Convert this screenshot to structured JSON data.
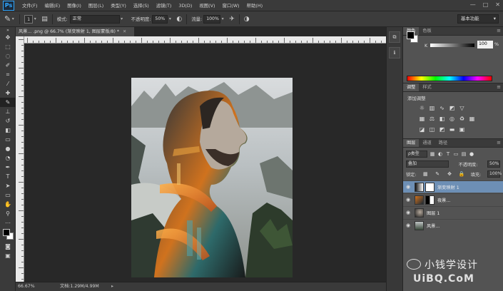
{
  "menubar": {
    "logo": "Ps",
    "items": [
      "文件(F)",
      "编辑(E)",
      "图像(I)",
      "图层(L)",
      "类型(Y)",
      "选择(S)",
      "滤镜(T)",
      "3D(D)",
      "视图(V)",
      "窗口(W)",
      "帮助(H)"
    ],
    "window_controls": [
      "—",
      "□",
      "✕"
    ]
  },
  "options": {
    "brush_size": "1",
    "mode_label": "模式:",
    "mode_value": "正常",
    "opacity_label": "不透明度:",
    "opacity_value": "50%",
    "flow_label": "流量:",
    "flow_value": "100%",
    "workspace": "基本功能"
  },
  "document": {
    "tab_title": "风景... .png @ 66.7% (渐变映射 1, 图层蒙版/8) *",
    "zoom": "66.67%",
    "doc_size": "文档:1.29M/4.99M"
  },
  "panels": {
    "color_tabs": [
      "颜色",
      "色板"
    ],
    "color_k_label": "K",
    "color_k_value": "100",
    "color_k_unit": "%",
    "adj_tabs": [
      "调整",
      "样式"
    ],
    "adj_title": "添加调整",
    "layers_tabs": [
      "图层",
      "通道",
      "路径"
    ],
    "kind_label": "ρ类型",
    "blend_mode": "叠加",
    "opacity_label": "不透明度:",
    "opacity_value": "50%",
    "lock_label": "锁定:",
    "fill_label": "填充:",
    "fill_value": "100%"
  },
  "layers": [
    {
      "name": "渐变映射 1",
      "selected": true
    },
    {
      "name": "夜景...",
      "selected": false
    },
    {
      "name": "图层 1",
      "selected": false
    },
    {
      "name": "风景...",
      "selected": false
    }
  ],
  "watermark": {
    "line1": "小钱学设计",
    "line2": "UiBQ.CoM"
  },
  "colors": {
    "selected_layer": "#6d8fb5",
    "panel_bg": "#535353",
    "canvas_bg": "#282828"
  }
}
